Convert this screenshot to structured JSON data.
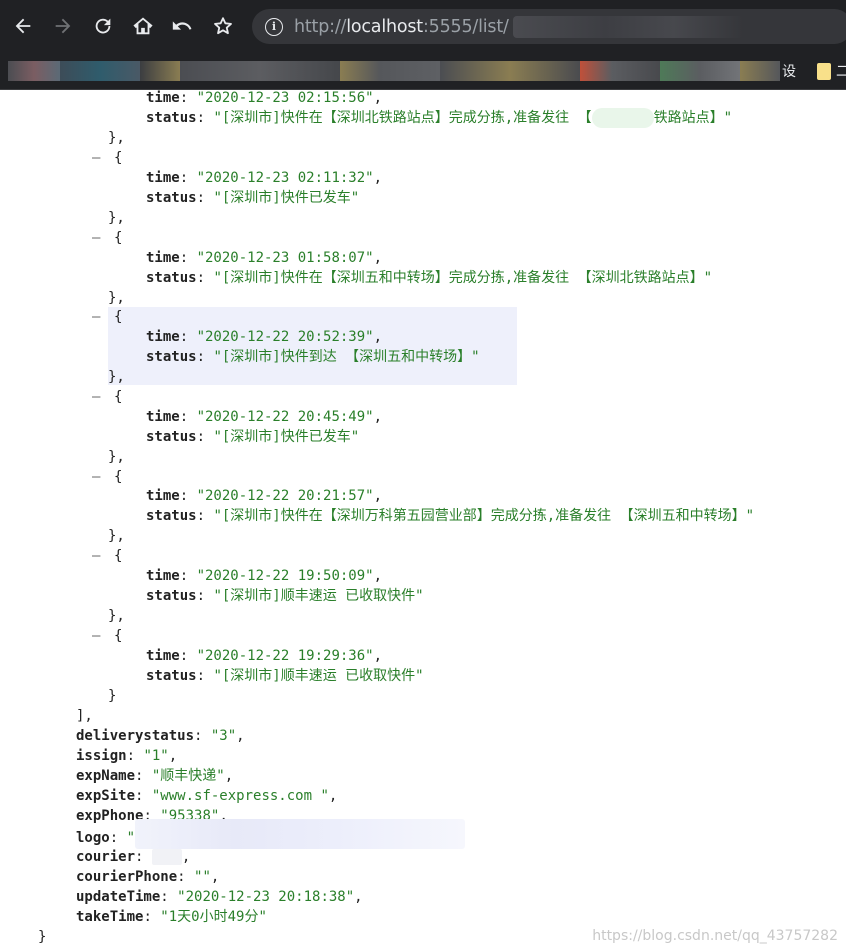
{
  "browser": {
    "url_scheme": "http://",
    "url_host": "localhost",
    "url_rest": ":5555/list/",
    "bookmark_visible_text": "设",
    "bookmark_more_text": "二",
    "icons": [
      "back-arrow-icon",
      "forward-arrow-icon",
      "reload-icon",
      "home-icon",
      "undo-icon",
      "star-icon",
      "info-icon",
      "folder-icon"
    ]
  },
  "json": {
    "records": [
      {
        "time_key": "time",
        "time": "\"2020-12-23 02:15:56\"",
        "status_key": "status",
        "status_a": "\"[深圳市]快件在【深圳北铁路站点】完成分拣,准备发往 【",
        "status_b": "铁路站点】\""
      },
      {
        "time_key": "time",
        "time": "\"2020-12-23 02:11:32\"",
        "status_key": "status",
        "status": "\"[深圳市]快件已发车\""
      },
      {
        "time_key": "time",
        "time": "\"2020-12-23 01:58:07\"",
        "status_key": "status",
        "status": "\"[深圳市]快件在【深圳五和中转场】完成分拣,准备发往 【深圳北铁路站点】\""
      },
      {
        "time_key": "time",
        "time": "\"2020-12-22 20:52:39\"",
        "status_key": "status",
        "status": "\"[深圳市]快件到达 【深圳五和中转场】\""
      },
      {
        "time_key": "time",
        "time": "\"2020-12-22 20:45:49\"",
        "status_key": "status",
        "status": "\"[深圳市]快件已发车\""
      },
      {
        "time_key": "time",
        "time": "\"2020-12-22 20:21:57\"",
        "status_key": "status",
        "status": "\"[深圳市]快件在【深圳万科第五园营业部】完成分拣,准备发往 【深圳五和中转场】\""
      },
      {
        "time_key": "time",
        "time": "\"2020-12-22 19:50:09\"",
        "status_key": "status",
        "status": "\"[深圳市]顺丰速运 已收取快件\""
      },
      {
        "time_key": "time",
        "time": "\"2020-12-22 19:29:36\"",
        "status_key": "status",
        "status": "\"[深圳市]顺丰速运 已收取快件\""
      }
    ],
    "fields": {
      "deliverystatus": {
        "key": "deliverystatus",
        "value": "\"3\""
      },
      "issign": {
        "key": "issign",
        "value": "\"1\""
      },
      "expName": {
        "key": "expName",
        "value": "\"顺丰快递\""
      },
      "expSite": {
        "key": "expSite",
        "value": "\"www.sf-express.com \""
      },
      "expPhone": {
        "key": "expPhone",
        "value": "\"95338\""
      },
      "logo": {
        "key": "logo",
        "value": "\""
      },
      "courier": {
        "key": "courier",
        "value": ""
      },
      "courierPhone": {
        "key": "courierPhone",
        "value": "\"\""
      },
      "updateTime": {
        "key": "updateTime",
        "value": "\"2020-12-23 20:18:38\""
      },
      "takeTime": {
        "key": "takeTime",
        "value": "\"1天0小时49分\""
      }
    },
    "toggle_symbol": "–",
    "open_brace": "{",
    "close_brace": "}",
    "close_brace_comma": "},",
    "close_bracket_comma": "],"
  },
  "watermark": "https://blog.csdn.net/qq_43757282"
}
